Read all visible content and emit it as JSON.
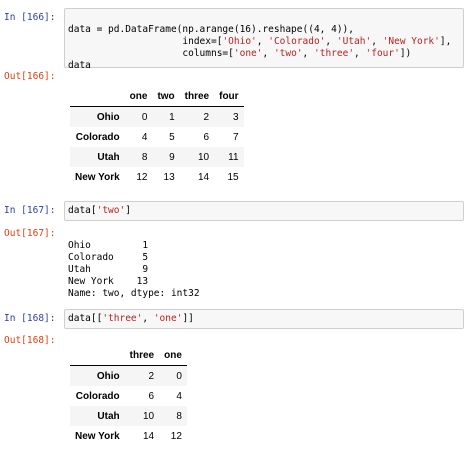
{
  "cells": [
    {
      "in_prompt": "In [166]:",
      "out_prompt": "Out[166]:",
      "code_lines": [
        "data = pd.DataFrame(np.arange(16).reshape((4, 4)),",
        "                    index=['Ohio', 'Colorado', 'Utah', 'New York'],",
        "                    columns=['one', 'two', 'three', 'four'])",
        "data"
      ],
      "table": {
        "columns": [
          "one",
          "two",
          "three",
          "four"
        ],
        "rows": [
          {
            "index": "Ohio",
            "values": [
              "0",
              "1",
              "2",
              "3"
            ]
          },
          {
            "index": "Colorado",
            "values": [
              "4",
              "5",
              "6",
              "7"
            ]
          },
          {
            "index": "Utah",
            "values": [
              "8",
              "9",
              "10",
              "11"
            ]
          },
          {
            "index": "New York",
            "values": [
              "12",
              "13",
              "14",
              "15"
            ]
          }
        ]
      }
    },
    {
      "in_prompt": "In [167]:",
      "out_prompt": "Out[167]:",
      "code_lines": [
        "data['two']"
      ],
      "text_output": [
        "Ohio         1",
        "Colorado     5",
        "Utah         9",
        "New York    13",
        "Name: two, dtype: int32"
      ]
    },
    {
      "in_prompt": "In [168]:",
      "out_prompt": "Out[168]:",
      "code_lines": [
        "data[['three', 'one']]"
      ],
      "table": {
        "columns": [
          "three",
          "one"
        ],
        "rows": [
          {
            "index": "Ohio",
            "values": [
              "2",
              "0"
            ]
          },
          {
            "index": "Colorado",
            "values": [
              "6",
              "4"
            ]
          },
          {
            "index": "Utah",
            "values": [
              "10",
              "8"
            ]
          },
          {
            "index": "New York",
            "values": [
              "14",
              "12"
            ]
          }
        ]
      }
    }
  ],
  "colors": {
    "in_prompt": "#303f9f",
    "out_prompt": "#d84315",
    "string": "#ba2121",
    "cell_bg": "#f7f7f7"
  }
}
